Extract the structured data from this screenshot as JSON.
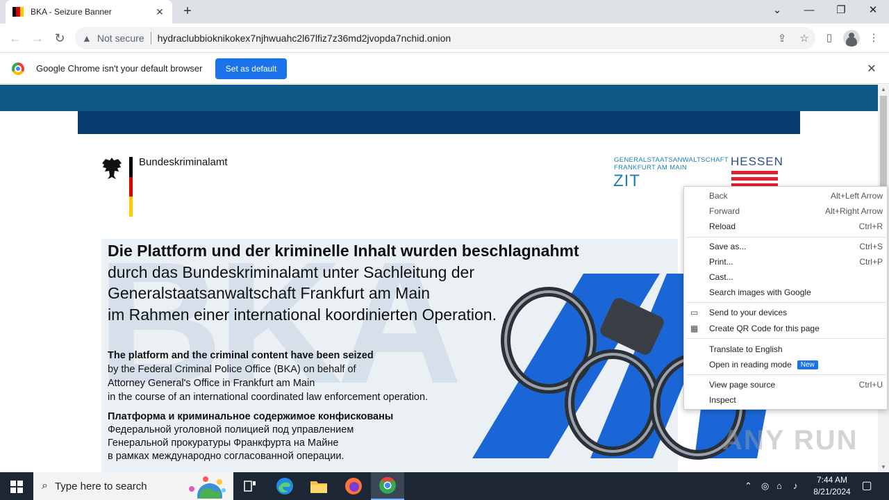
{
  "browser": {
    "tab_title": "BKA - Seizure Banner",
    "not_secure": "Not secure",
    "url": "hydraclubbioknikokex7njhwuahc2l67lfiz7z36md2jvopda7nchid.onion"
  },
  "infobar": {
    "message": "Google Chrome isn't your default browser",
    "button": "Set as default"
  },
  "page": {
    "agency_name": "Bundeskriminalamt",
    "gsta_line1": "GENERALSTAATSANWALTSCHAFT",
    "gsta_line2": "FRANKFURT AM MAIN",
    "zit": "ZIT",
    "hessen": "HESSEN",
    "watermark": "BKA",
    "de_title": "Die Plattform und der kriminelle Inhalt wurden beschlagnahmt",
    "de_line2": "durch das Bundeskriminalamt unter Sachleitung der",
    "de_line3": "Generalstaatsanwaltschaft Frankfurt am Main",
    "de_line4": "im Rahmen einer international koordinierten Operation.",
    "en_title": "The platform and the criminal content have been seized",
    "en_line2": "by the Federal Criminal Police Office (BKA) on behalf of",
    "en_line3": "Attorney General's Office in Frankfurt am Main",
    "en_line4": "in the course of an international coordinated law enforcement operation.",
    "ru_title": "Платформа и криминальное содержимое конфискованы",
    "ru_line2": "Федеральной уголовной полицией под управлением",
    "ru_line3": "Генеральной прокуратуры Франкфурта на Майне",
    "ru_line4": "в рамках международно согласованной операции.",
    "anyrun": "ANY RUN"
  },
  "context_menu": {
    "items": [
      {
        "label": "Back",
        "shortcut": "Alt+Left Arrow"
      },
      {
        "label": "Forward",
        "shortcut": "Alt+Right Arrow"
      },
      {
        "label": "Reload",
        "shortcut": "Ctrl+R"
      },
      {
        "label": "Save as...",
        "shortcut": "Ctrl+S"
      },
      {
        "label": "Print...",
        "shortcut": "Ctrl+P"
      },
      {
        "label": "Cast...",
        "shortcut": ""
      },
      {
        "label": "Search images with Google",
        "shortcut": ""
      },
      {
        "label": "Send to your devices",
        "shortcut": ""
      },
      {
        "label": "Create QR Code for this page",
        "shortcut": ""
      },
      {
        "label": "Translate to English",
        "shortcut": ""
      },
      {
        "label": "Open in reading mode",
        "shortcut": "",
        "badge": "New"
      },
      {
        "label": "View page source",
        "shortcut": "Ctrl+U"
      },
      {
        "label": "Inspect",
        "shortcut": ""
      }
    ]
  },
  "taskbar": {
    "search_placeholder": "Type here to search",
    "time": "7:44 AM",
    "date": "8/21/2024"
  },
  "colors": {
    "band_top": "#0f5988",
    "band_inner": "#083c6e",
    "accent_blue": "#1a73e8",
    "zit_blue": "#1d7fb3"
  }
}
